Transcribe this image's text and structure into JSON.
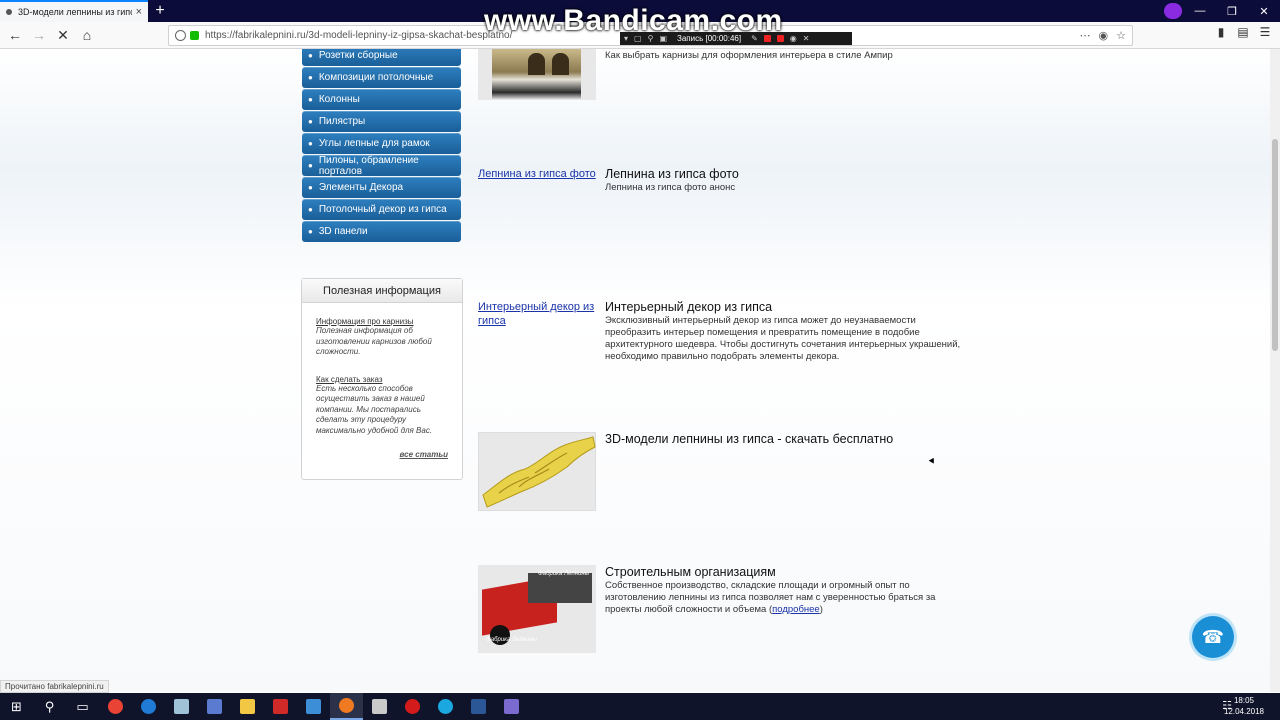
{
  "browser": {
    "tab_title": "3D-модели лепнины из гипса",
    "tab_close": "×",
    "new_tab": "+",
    "url": "https://fabrikalepnini.ru/3d-modeli-lepniny-iz-gipsa-skachat-besplatno/",
    "window_controls": [
      "—",
      "❐",
      "✕"
    ]
  },
  "recorder": {
    "watermark": "www.Bandicam.com",
    "status": "Запись [00:00:46]"
  },
  "sidebar": {
    "items": [
      {
        "label": "Розетки сборные"
      },
      {
        "label": "Композиции потолочные"
      },
      {
        "label": "Колонны"
      },
      {
        "label": "Пилястры"
      },
      {
        "label": "Углы лепные для рамок"
      },
      {
        "label": "Пилоны, обрамление порталов"
      },
      {
        "label": "Элементы Декора"
      },
      {
        "label": "Потолочный декор из гипса"
      },
      {
        "label": "3D панели"
      }
    ]
  },
  "info_box": {
    "title": "Полезная информация",
    "entries": [
      {
        "title": "Информация про карнизы",
        "desc": "Полезная информация об изготовлении карнизов любой сложности."
      },
      {
        "title": "Как сделать заказ",
        "desc": "Есть несколько способов осуществить заказ в нашей компании. Мы постарались сделать эту процедуру максимально удобной для Вас."
      }
    ],
    "all_link": "все статьи"
  },
  "articles": [
    {
      "title": "",
      "text": "Как выбрать карнизы для оформления интерьера в стиле Ампир",
      "thumb": "hall-image"
    },
    {
      "link": "Лепнина из гипса фото",
      "title": "Лепнина из гипса фото",
      "text": "Лепнина из гипса фото анонс"
    },
    {
      "link": "Интерьерный декор из гипса",
      "title": "Интерьерный декор из гипса",
      "text": "Эксклюзивный интерьерный декор из гипса может до неузнаваемости преобразить интерьер помещения и превратить помещение в подобие архитектурного шедевра. Чтобы достигнуть сочетания интерьерных украшений, необходимо правильно подобрать элементы декора."
    },
    {
      "title": "3D-модели лепнины из гипса - скачать бесплатно",
      "text": "",
      "thumb": "3d-model-image"
    },
    {
      "title": "Строительным организациям",
      "text": "Собственное производство, складские площади и огромный опыт по изготовлению лепнины из гипса позволяет нам с уверенностью браться за проекты любой сложности и объема (",
      "more_link": "подробнее",
      "text_end": ")",
      "thumb_caption_top": "Фабрика Лепнины",
      "thumb_caption_bottom": "Фабрика Лепнины"
    }
  ],
  "status_bar": "Прочитано fabrikalepnini.ru",
  "clock": {
    "time": "18:05",
    "date": "12.04.2018"
  },
  "colors": {
    "menu_blue": "#1a5f99",
    "link": "#1a33a8",
    "taskbar": "#10142a"
  }
}
